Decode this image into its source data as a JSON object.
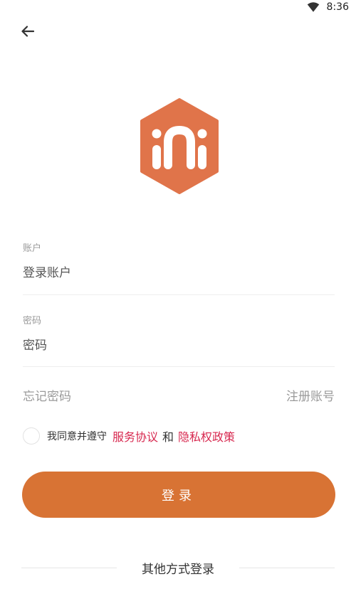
{
  "status_bar": {
    "time": "8:36",
    "icons": [
      "wifi-icon"
    ]
  },
  "header": {
    "back_icon": "arrow-left-icon"
  },
  "brand": {
    "logo_color": "#e0744a",
    "logo_icon": "hexagon-m-logo"
  },
  "account": {
    "label": "账户",
    "placeholder": "登录账户"
  },
  "password": {
    "label": "密码",
    "placeholder": "密码"
  },
  "links": {
    "forgot": "忘记密码",
    "register": "注册账号"
  },
  "agreement": {
    "prefix": "我同意并遵守",
    "service": "服务协议",
    "and": "和",
    "privacy": "隐私权政策",
    "link_color": "#d7284f"
  },
  "login_button": {
    "label": "登录",
    "color": "#d87334"
  },
  "other_login": {
    "label": "其他方式登录"
  }
}
